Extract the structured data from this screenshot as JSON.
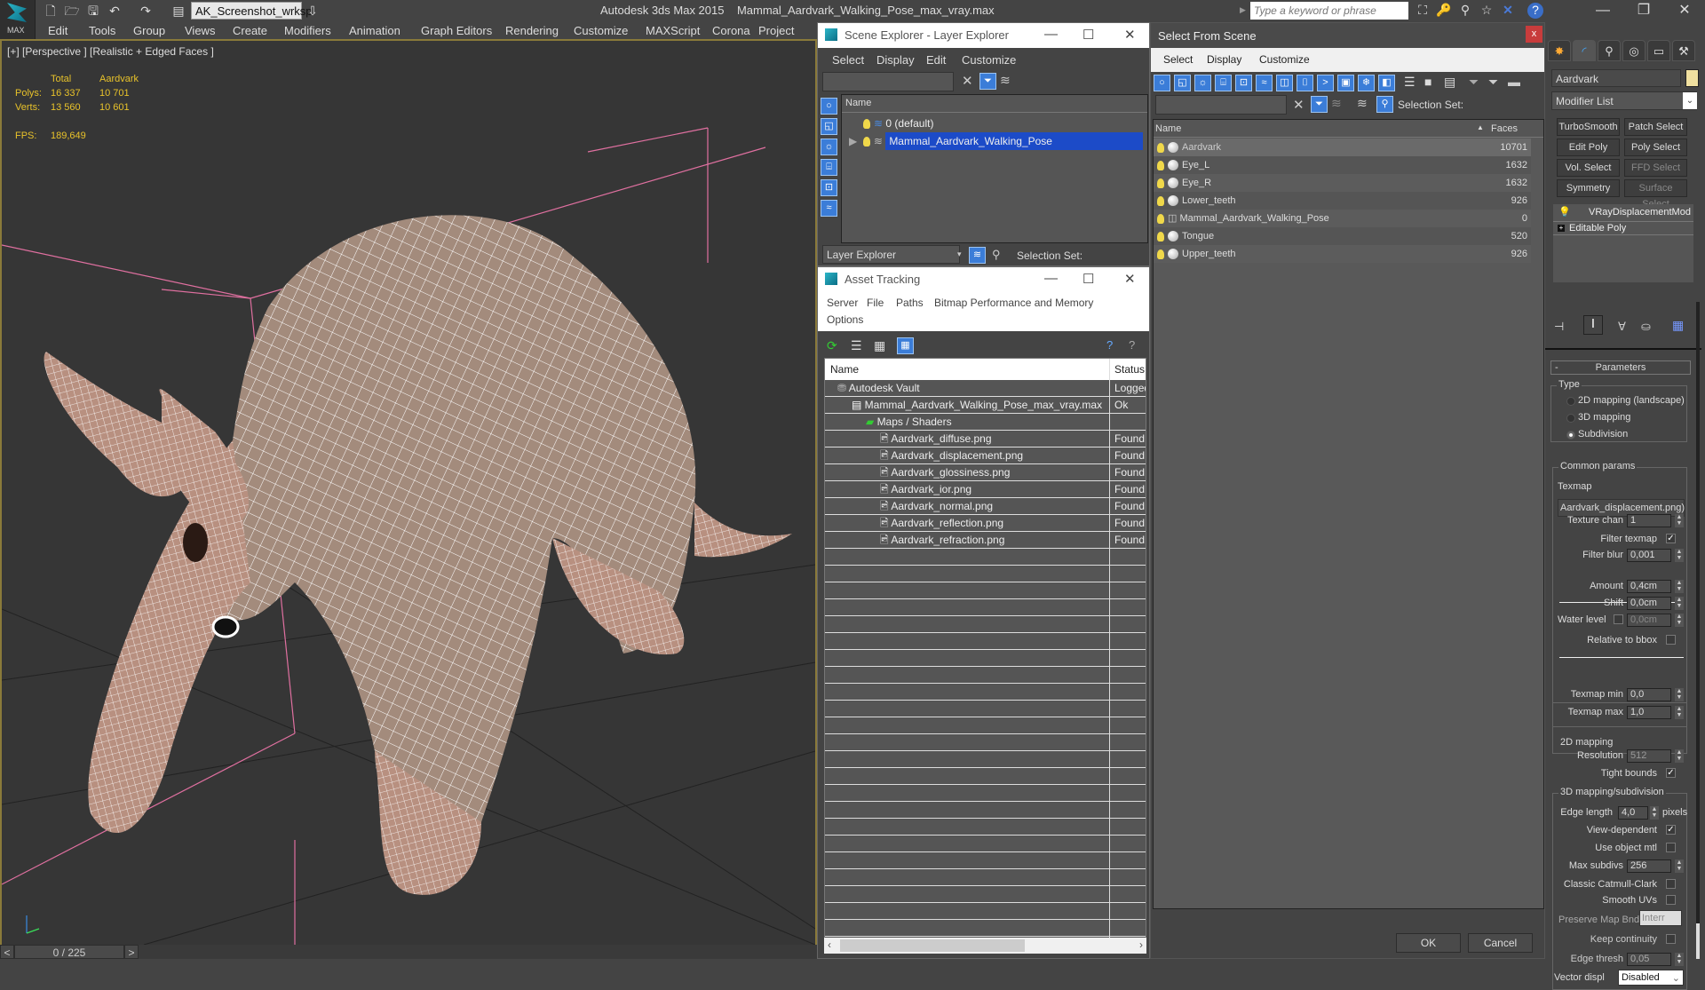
{
  "titlebar": {
    "workspace": "AK_Screenshot_wrksp",
    "app_title": "Autodesk 3ds Max  2015",
    "file_title": "Mammal_Aardvark_Walking_Pose_max_vray.max",
    "search_placeholder": "Type a keyword or phrase",
    "logo_label": "MAX"
  },
  "menubar": [
    "Edit",
    "Tools",
    "Group",
    "Views",
    "Create",
    "Modifiers",
    "Animation",
    "Graph Editors",
    "Rendering",
    "Customize",
    "MAXScript",
    "Corona",
    "Project Man"
  ],
  "viewport": {
    "label": "[+] [Perspective ] [Realistic + Edged Faces ]",
    "stats": {
      "col_total": "Total",
      "col_object": "Aardvark",
      "polys_label": "Polys:",
      "polys_total": "16 337",
      "polys_object": "10 701",
      "verts_label": "Verts:",
      "verts_total": "13 560",
      "verts_object": "10 601",
      "fps_label": "FPS:",
      "fps": "189,649"
    },
    "mesh_color": "#a08878",
    "wire_color": "#ffffff",
    "bbox_color": "#e070a0"
  },
  "timeline": {
    "prev": "<",
    "frame": "0 / 225",
    "next": ">"
  },
  "scene_explorer": {
    "title": "Scene Explorer - Layer Explorer",
    "menu": [
      "Select",
      "Display",
      "Edit",
      "Customize"
    ],
    "column": "Name",
    "layers": [
      {
        "name": "0 (default)",
        "selected": false
      },
      {
        "name": "Mammal_Aardvark_Walking_Pose",
        "selected": true
      }
    ],
    "footer_dropdown": "Layer Explorer",
    "selection_set_label": "Selection Set:"
  },
  "asset_tracking": {
    "title": "Asset Tracking",
    "menu": [
      "Server",
      "File",
      "Paths",
      "Bitmap Performance and Memory",
      "Options"
    ],
    "columns": [
      "Name",
      "Status"
    ],
    "rows": [
      {
        "name": "Autodesk Vault",
        "status": "Logged",
        "indent": 0,
        "icon": "vault-icon"
      },
      {
        "name": "Mammal_Aardvark_Walking_Pose_max_vray.max",
        "status": "Ok",
        "indent": 1,
        "icon": "max-file-icon"
      },
      {
        "name": "Maps / Shaders",
        "status": "",
        "indent": 2,
        "icon": "maps-icon"
      },
      {
        "name": "Aardvark_diffuse.png",
        "status": "Found",
        "indent": 3,
        "icon": "bitmap-icon"
      },
      {
        "name": "Aardvark_displacement.png",
        "status": "Found",
        "indent": 3,
        "icon": "bitmap-icon"
      },
      {
        "name": "Aardvark_glossiness.png",
        "status": "Found",
        "indent": 3,
        "icon": "bitmap-icon"
      },
      {
        "name": "Aardvark_ior.png",
        "status": "Found",
        "indent": 3,
        "icon": "bitmap-icon"
      },
      {
        "name": "Aardvark_normal.png",
        "status": "Found",
        "indent": 3,
        "icon": "bitmap-icon"
      },
      {
        "name": "Aardvark_reflection.png",
        "status": "Found",
        "indent": 3,
        "icon": "bitmap-icon"
      },
      {
        "name": "Aardvark_refraction.png",
        "status": "Found",
        "indent": 3,
        "icon": "bitmap-icon"
      }
    ]
  },
  "select_from_scene": {
    "title": "Select From Scene",
    "close": "x",
    "menu": [
      "Select",
      "Display",
      "Customize"
    ],
    "selection_set_label": "Selection Set:",
    "columns": [
      "Name",
      "Faces"
    ],
    "objects": [
      {
        "name": "Aardvark",
        "faces": "10701",
        "selected": true,
        "icon": "sphere"
      },
      {
        "name": "Eye_L",
        "faces": "1632",
        "selected": false,
        "icon": "sphere"
      },
      {
        "name": "Eye_R",
        "faces": "1632",
        "selected": false,
        "icon": "sphere"
      },
      {
        "name": "Lower_teeth",
        "faces": "926",
        "selected": false,
        "icon": "sphere"
      },
      {
        "name": "Mammal_Aardvark_Walking_Pose",
        "faces": "0",
        "selected": false,
        "icon": "group"
      },
      {
        "name": "Tongue",
        "faces": "520",
        "selected": false,
        "icon": "sphere"
      },
      {
        "name": "Upper_teeth",
        "faces": "926",
        "selected": false,
        "icon": "sphere"
      }
    ],
    "ok": "OK",
    "cancel": "Cancel"
  },
  "command_panel": {
    "object_name": "Aardvark",
    "object_color": "#f0e0a0",
    "modifier_list": "Modifier List",
    "modifier_buttons": [
      "TurboSmooth",
      "Patch Select",
      "Edit Poly",
      "Poly Select",
      "Vol. Select",
      "FFD Select",
      "Symmetry",
      "Surface Select"
    ],
    "stack": [
      "VRayDisplacementMod",
      "Editable Poly"
    ],
    "params": {
      "rollout": "Parameters",
      "type_group": "Type",
      "type_options": [
        "2D mapping (landscape)",
        "3D mapping",
        "Subdivision"
      ],
      "type_selected": "Subdivision",
      "common_group": "Common params",
      "texmap_label": "Texmap",
      "texmap": "Aardvark_displacement.png)",
      "texture_chan_label": "Texture chan",
      "texture_chan": "1",
      "filter_texmap_label": "Filter texmap",
      "filter_texmap": true,
      "filter_blur_label": "Filter blur",
      "filter_blur": "0,001",
      "amount_label": "Amount",
      "amount": "0,4cm",
      "shift_label": "Shift",
      "shift": "0,0cm",
      "water_level_label": "Water level",
      "water_level": "0,0cm",
      "relative_bbox_label": "Relative to bbox",
      "texmap_min_label": "Texmap min",
      "texmap_min": "0,0",
      "texmap_max_label": "Texmap max",
      "texmap_max": "1,0",
      "mapping2d_group": "2D mapping",
      "resolution_label": "Resolution",
      "resolution": "512",
      "tight_bounds_label": "Tight bounds",
      "mapping3d_group": "3D mapping/subdivision",
      "edge_length_label": "Edge length",
      "edge_length": "4,0",
      "pixels_label": "pixels",
      "view_dependent_label": "View-dependent",
      "use_object_mtl_label": "Use object mtl",
      "max_subdivs_label": "Max subdivs",
      "max_subdivs": "256",
      "catmull_label": "Classic Catmull-Clark",
      "smooth_uvs_label": "Smooth UVs",
      "preserve_label": "Preserve Map Bnd",
      "preserve": "Interr",
      "keep_cont_label": "Keep continuity",
      "edge_thresh_label": "Edge thresh",
      "edge_thresh": "0,05",
      "vector_displ_label": "Vector displ",
      "vector_displ": "Disabled"
    }
  }
}
